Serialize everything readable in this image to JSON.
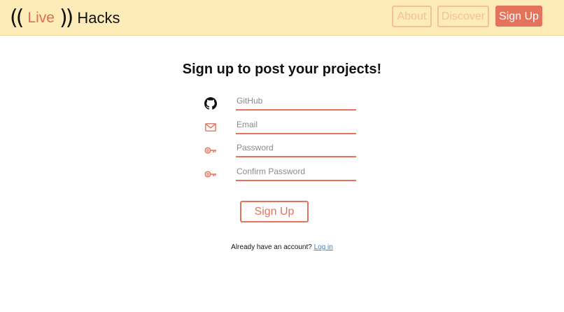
{
  "nav": {
    "logo": {
      "paren_left": "((",
      "live": "Live",
      "paren_right": "))",
      "hacks": "Hacks"
    },
    "about_label": "About",
    "discover_label": "Discover",
    "signup_label": "Sign Up"
  },
  "form": {
    "heading": "Sign up to post your projects!",
    "github_placeholder": "GitHub",
    "email_placeholder": "Email",
    "password_placeholder": "Password",
    "confirm_placeholder": "Confirm Password",
    "submit_label": "Sign Up",
    "login_prompt": "Already have an account?",
    "login_link": "Log in",
    "icons": [
      "github-icon",
      "mail-icon",
      "key-icon",
      "key-icon"
    ]
  },
  "colors": {
    "accent": "#e4735b",
    "navbar_bg": "#fdecb7",
    "nav_outline": "#f5bf9e",
    "link": "#3b7fc4"
  }
}
